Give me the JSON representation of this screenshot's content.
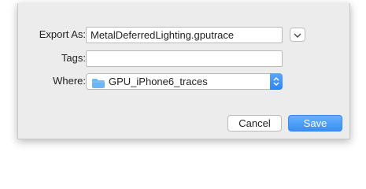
{
  "dialog": {
    "export_as_label": "Export As:",
    "export_as_value": "MetalDeferredLighting.gputrace",
    "tags_label": "Tags:",
    "tags_value": "",
    "where_label": "Where:",
    "where_value": "GPU_iPhone6_traces",
    "cancel_label": "Cancel",
    "save_label": "Save"
  },
  "icons": {
    "expand": "chevron-down-icon",
    "location": "folder-icon",
    "stepper": "up-down-chevron-icon"
  },
  "colors": {
    "accent": "#3a8ef6",
    "folder": "#6cb6f5",
    "sheet_background": "#ececec"
  }
}
